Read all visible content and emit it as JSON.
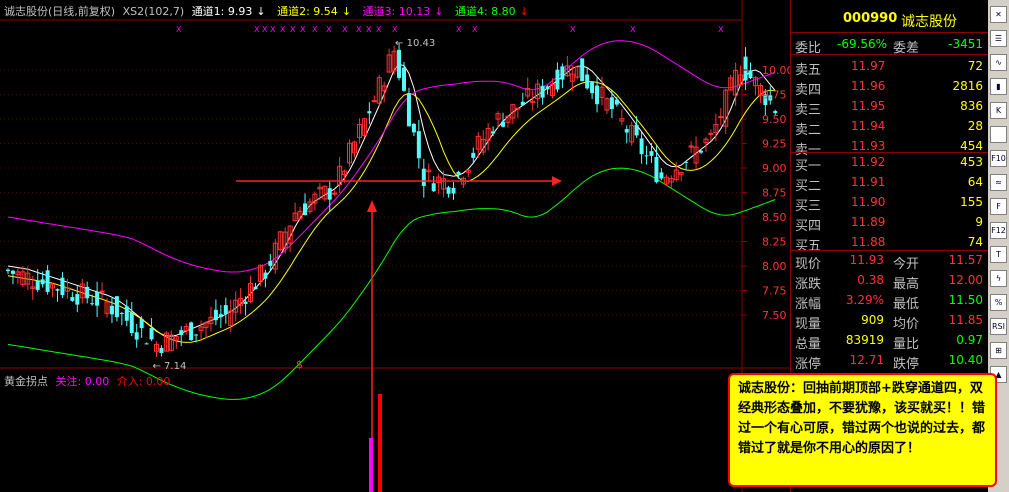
{
  "header": {
    "title": "诚志股份(日线,前复权)",
    "indicator": "XS2(102,7)",
    "ch1": "通道1: 9.93",
    "ch2": "通道2: 9.54",
    "ch3": "通道3: 10.13",
    "ch4": "通道4: 8.80",
    "arrow": "↓",
    "x_marker": "X"
  },
  "chart_labels": {
    "high": "10.43",
    "low": "7.14",
    "dollar": "$"
  },
  "price_axis": [
    "10.00",
    "9.75",
    "9.50",
    "9.25",
    "9.00",
    "8.75",
    "8.50",
    "8.25",
    "8.00",
    "7.75",
    "7.50"
  ],
  "indicator_panel": {
    "name": "黄金拐点",
    "watch": "关注: 0.00",
    "buy": "介入: 0.00"
  },
  "quote": {
    "code": "000990",
    "name": "诚志股份",
    "weibi_label": "委比",
    "weibi": "-69.56%",
    "weicha_label": "委差",
    "weicha": "-3451",
    "asks": [
      {
        "label": "卖五",
        "price": "11.97",
        "vol": "72"
      },
      {
        "label": "卖四",
        "price": "11.96",
        "vol": "2816"
      },
      {
        "label": "卖三",
        "price": "11.95",
        "vol": "836"
      },
      {
        "label": "卖二",
        "price": "11.94",
        "vol": "28"
      },
      {
        "label": "卖一",
        "price": "11.93",
        "vol": "454"
      }
    ],
    "bids": [
      {
        "label": "买一",
        "price": "11.92",
        "vol": "453"
      },
      {
        "label": "买二",
        "price": "11.91",
        "vol": "64"
      },
      {
        "label": "买三",
        "price": "11.90",
        "vol": "155"
      },
      {
        "label": "买四",
        "price": "11.89",
        "vol": "9"
      },
      {
        "label": "买五",
        "price": "11.88",
        "vol": "74"
      }
    ],
    "stats": [
      {
        "l1": "现价",
        "v1": "11.93",
        "l2": "今开",
        "v2": "11.57"
      },
      {
        "l1": "涨跌",
        "v1": "0.38",
        "l2": "最高",
        "v2": "12.00"
      },
      {
        "l1": "涨幅",
        "v1": "3.29%",
        "l2": "最低",
        "v2": "11.50"
      },
      {
        "l1": "现量",
        "v1": "909",
        "l2": "均价",
        "v2": "11.85"
      },
      {
        "l1": "总量",
        "v1": "83919",
        "l2": "量比",
        "v2": "0.97"
      },
      {
        "l1": "涨停",
        "v1": "12.71",
        "l2": "跌停",
        "v2": "10.40"
      }
    ]
  },
  "toolbar_icons": [
    "close",
    "list",
    "line",
    "candle",
    "k",
    "d",
    "f10",
    "ma",
    "f",
    "f12",
    "t",
    "bolt",
    "pct",
    "rsi",
    "misc",
    "up"
  ],
  "toolbar_labels": {
    "k": "K",
    "f10": "F10",
    "f": "F",
    "f12": "F12",
    "rsi": "RSI"
  },
  "callout": {
    "text": "诚志股份：回抽前期顶部+跌穿通道四，双经典形态叠加，不要犹豫，该买就买！！错过一个有心可原，错过两个也说的过去，都错过了就是你不用心的原因了！"
  },
  "colors": {
    "up": "#ff3232",
    "down": "#54fcfc",
    "white_line": "#ffffff",
    "yellow_line": "#ffff00",
    "magenta": "#ff00ff",
    "green": "#00ff00"
  }
}
